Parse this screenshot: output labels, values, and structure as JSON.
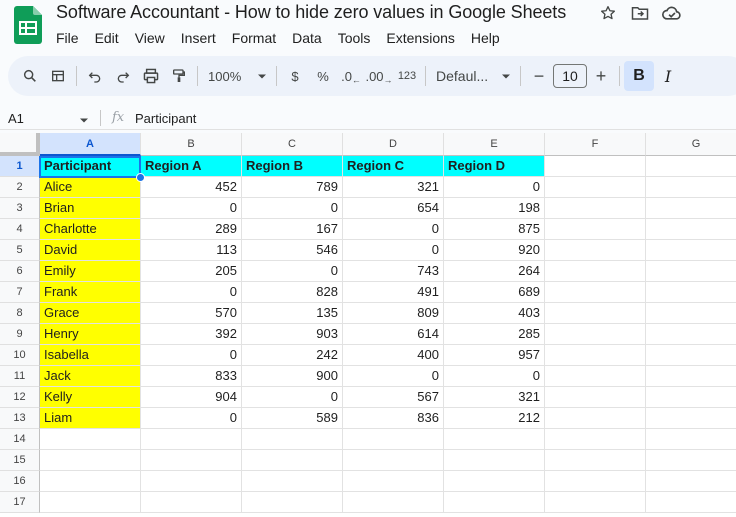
{
  "app": {
    "title": "Software Accountant - How to hide zero values in Google Sheets",
    "brand_color": "#0f9d58",
    "accent_color": "#0b57d0"
  },
  "menu": [
    "File",
    "Edit",
    "View",
    "Insert",
    "Format",
    "Data",
    "Tools",
    "Extensions",
    "Help"
  ],
  "title_icons": [
    "star-icon",
    "move-to-folder-icon",
    "cloud-status-icon"
  ],
  "toolbar": {
    "zoom": "100%",
    "currency_label": "$",
    "percent_label": "%",
    "decrease_decimal_label": ".0",
    "increase_decimal_label": ".00",
    "number_format_label": "123",
    "font": "Defaul...",
    "font_size": "10",
    "minus_label": "−",
    "plus_label": "+",
    "bold_label": "B",
    "italic_label": "I"
  },
  "formula_bar": {
    "cell_ref": "A1",
    "fx": "fx",
    "content": "Participant"
  },
  "sheet": {
    "columns": [
      "A",
      "B",
      "C",
      "D",
      "E",
      "F",
      "G"
    ],
    "rows": [
      "1",
      "2",
      "3",
      "4",
      "5",
      "6",
      "7",
      "8",
      "9",
      "10",
      "11",
      "12",
      "13",
      "14",
      "15",
      "16",
      "17"
    ],
    "header": [
      "Participant",
      "Region A",
      "Region B",
      "Region C",
      "Region D"
    ],
    "data": [
      [
        "Alice",
        "452",
        "789",
        "321",
        "0"
      ],
      [
        "Brian",
        "0",
        "0",
        "654",
        "198"
      ],
      [
        "Charlotte",
        "289",
        "167",
        "0",
        "875"
      ],
      [
        "David",
        "113",
        "546",
        "0",
        "920"
      ],
      [
        "Emily",
        "205",
        "0",
        "743",
        "264"
      ],
      [
        "Frank",
        "0",
        "828",
        "491",
        "689"
      ],
      [
        "Grace",
        "570",
        "135",
        "809",
        "403"
      ],
      [
        "Henry",
        "392",
        "903",
        "614",
        "285"
      ],
      [
        "Isabella",
        "0",
        "242",
        "400",
        "957"
      ],
      [
        "Jack",
        "833",
        "900",
        "0",
        "0"
      ],
      [
        "Kelly",
        "904",
        "0",
        "567",
        "321"
      ],
      [
        "Liam",
        "0",
        "589",
        "836",
        "212"
      ]
    ],
    "header_fill": "#00ffff",
    "name_fill": "#ffff00",
    "selected_cell": "A1"
  }
}
